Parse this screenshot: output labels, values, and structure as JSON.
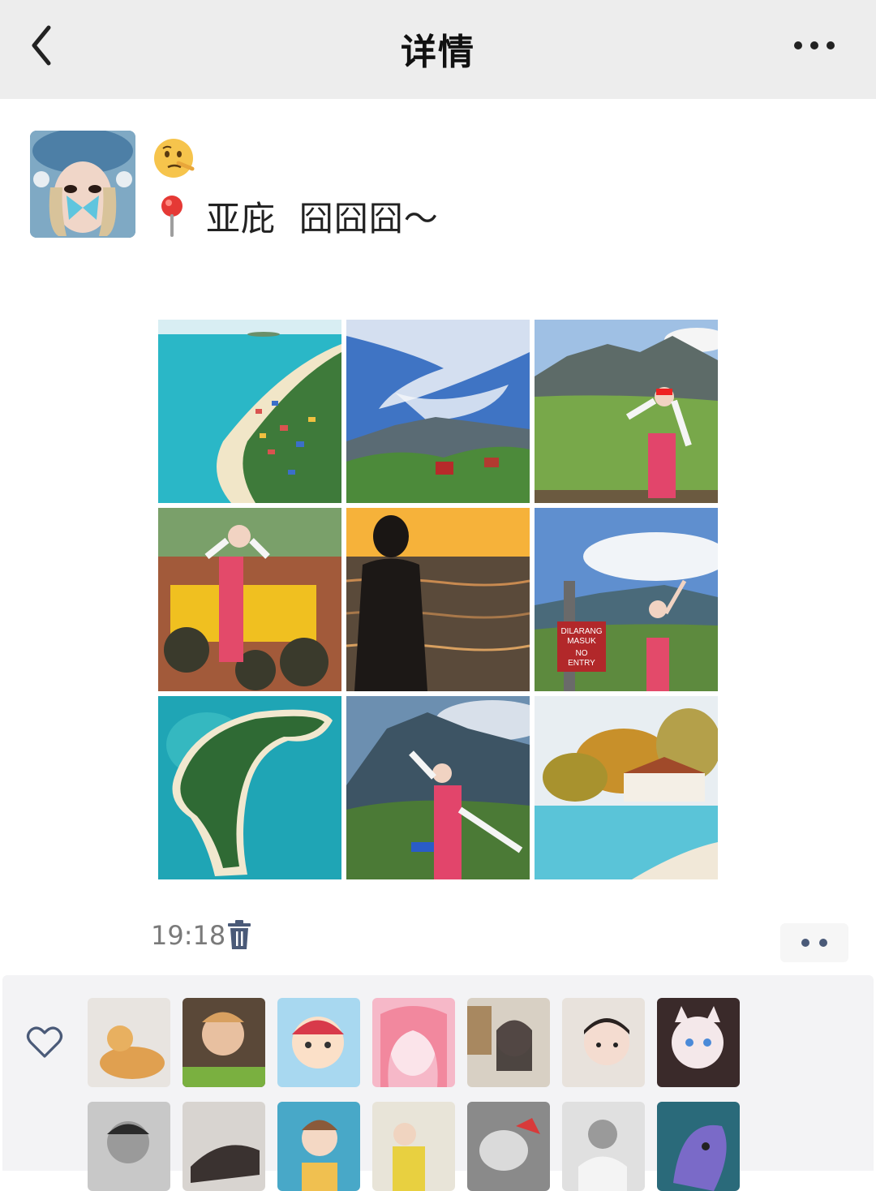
{
  "header": {
    "title": "详情",
    "back_icon": "chevron-left-icon",
    "more_icon": "more-horizontal-icon"
  },
  "post": {
    "author_avatar": "user-avatar-blue-hat-butterfly",
    "emoji": "thinking-face-emoji",
    "location_icon": "map-pin-icon",
    "text": "亚庇  囧囧囧～",
    "photos": [
      "aerial-beach-village",
      "cloudy-sky-mountain",
      "woman-mountain-meadow",
      "woman-atv",
      "silhouette-sunset-sea",
      "woman-dilarang-masuk-sign",
      "aerial-tropical-island",
      "woman-mountain-viewpoint",
      "beach-jetty-hut"
    ],
    "sign_text": [
      "DILARANG",
      "MASUK",
      "NO",
      "ENTRY"
    ],
    "time": "19:18",
    "delete_icon": "trash-icon",
    "actions_icon": "more-dots-icon"
  },
  "likes": {
    "heart_icon": "heart-outline-icon",
    "avatars": [
      "cat-orange",
      "man-phone",
      "cartoon-girl",
      "anime-pink-hair",
      "girl-bookshelf",
      "baby-girl",
      "fluffy-cat",
      "man-bw",
      "person-lying",
      "woman-teal-bg",
      "person-yellow",
      "bw-santa-hat",
      "man-white-shirt",
      "cartoon-blue"
    ]
  }
}
